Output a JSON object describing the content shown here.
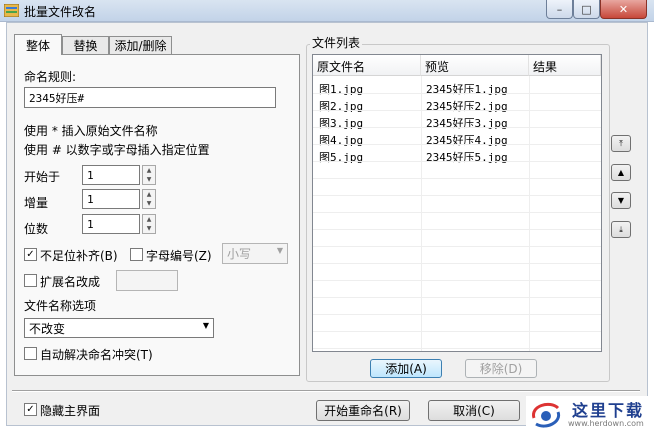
{
  "window": {
    "title": "批量文件改名",
    "controls": {
      "minimize": "–",
      "maximize": "□",
      "close": "✕"
    }
  },
  "tabs": [
    {
      "label": "整体",
      "active": true
    },
    {
      "label": "替换",
      "active": false
    },
    {
      "label": "添加/删除",
      "active": false
    }
  ],
  "rules": {
    "name_rule_label": "命名规则:",
    "name_rule_value": "2345好压#",
    "hint1": "使用 * 插入原始文件名称",
    "hint2": "使用 # 以数字或字母插入指定位置",
    "start_label": "开始于",
    "start_value": "1",
    "step_label": "增量",
    "step_value": "1",
    "digits_label": "位数",
    "digits_value": "1",
    "pad_label": "不足位补齐(B)",
    "pad_checked": true,
    "letter_label": "字母编号(Z)",
    "letter_checked": false,
    "case_value": "小写",
    "ext_label": "扩展名改成",
    "ext_checked": false,
    "ext_value": "",
    "options_label": "文件名称选项",
    "options_value": "不改变",
    "conflict_label": "自动解决命名冲突(T)",
    "conflict_checked": false
  },
  "file_list": {
    "group_title": "文件列表",
    "columns": [
      "原文件名",
      "预览",
      "结果"
    ],
    "rows": [
      {
        "original": "图1.jpg",
        "preview": "2345好压1.jpg",
        "result": ""
      },
      {
        "original": "图2.jpg",
        "preview": "2345好压2.jpg",
        "result": ""
      },
      {
        "original": "图3.jpg",
        "preview": "2345好压3.jpg",
        "result": ""
      },
      {
        "original": "图4.jpg",
        "preview": "2345好压4.jpg",
        "result": ""
      },
      {
        "original": "图5.jpg",
        "preview": "2345好压5.jpg",
        "result": ""
      }
    ],
    "add_button": "添加(A)",
    "remove_button": "移除(D)"
  },
  "order_buttons": {
    "top": "⤒",
    "up": "▲",
    "down": "▼",
    "bottom": "⤓"
  },
  "footer": {
    "hide_main_label": "隐藏主界面",
    "hide_main_checked": true,
    "start_rename_button": "开始重命名(R)",
    "cancel_button": "取消(C)"
  },
  "watermark": {
    "title": "这里下载",
    "url": "www.herdown.com"
  },
  "colors": {
    "selected_tab": "#f9f9f9",
    "primary_button": "#bee6fd",
    "titlebar": "#c2d3e8"
  }
}
